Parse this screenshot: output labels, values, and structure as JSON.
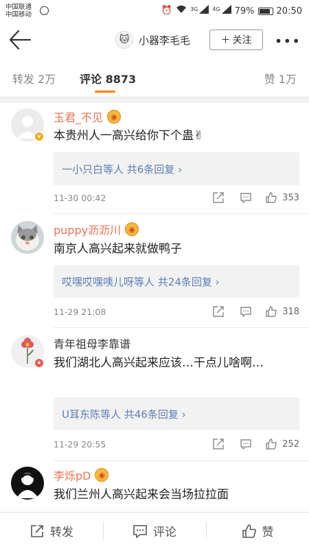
{
  "status_bar": {
    "carrier1": "中国联通",
    "carrier2": "中国移动",
    "net_label": "3G",
    "net_label2": "4G",
    "battery": "79%",
    "time": "20:50"
  },
  "header": {
    "author": "小器李毛毛",
    "follow_label": "关注"
  },
  "tabs": {
    "repost": "转发 2万",
    "comment": "评论 8873",
    "like": "赞 1万"
  },
  "comments": [
    {
      "user": "玉君_不见",
      "text": "本贵州人一高兴给你下个蛊✌",
      "reply": "一小只白等人 共6条回复 ›",
      "time": "11-30 00:42",
      "likes": "353"
    },
    {
      "user": "puppy沥沥川",
      "text": "南京人高兴起来就做鸭子",
      "reply": "哎嘿哎嘿咦儿呀等人 共24条回复 ›",
      "time": "11-29 21:08",
      "likes": "318"
    },
    {
      "user": "青年祖母李靠谱",
      "text": "我们湖北人高兴起来应该…干点儿啥啊…",
      "reply": "U耳东陈等人 共46条回复 ›",
      "time": "11-29 20:55",
      "likes": "252"
    },
    {
      "user": "李烁pD",
      "text": "我们兰州人高兴起来会当场拉拉面"
    }
  ],
  "toolbar": {
    "repost": "转发",
    "comment": "评论",
    "like": "赞"
  },
  "colors": {
    "accent": "#ff8200",
    "username": "#eb7350",
    "link": "#5d7eb5"
  }
}
